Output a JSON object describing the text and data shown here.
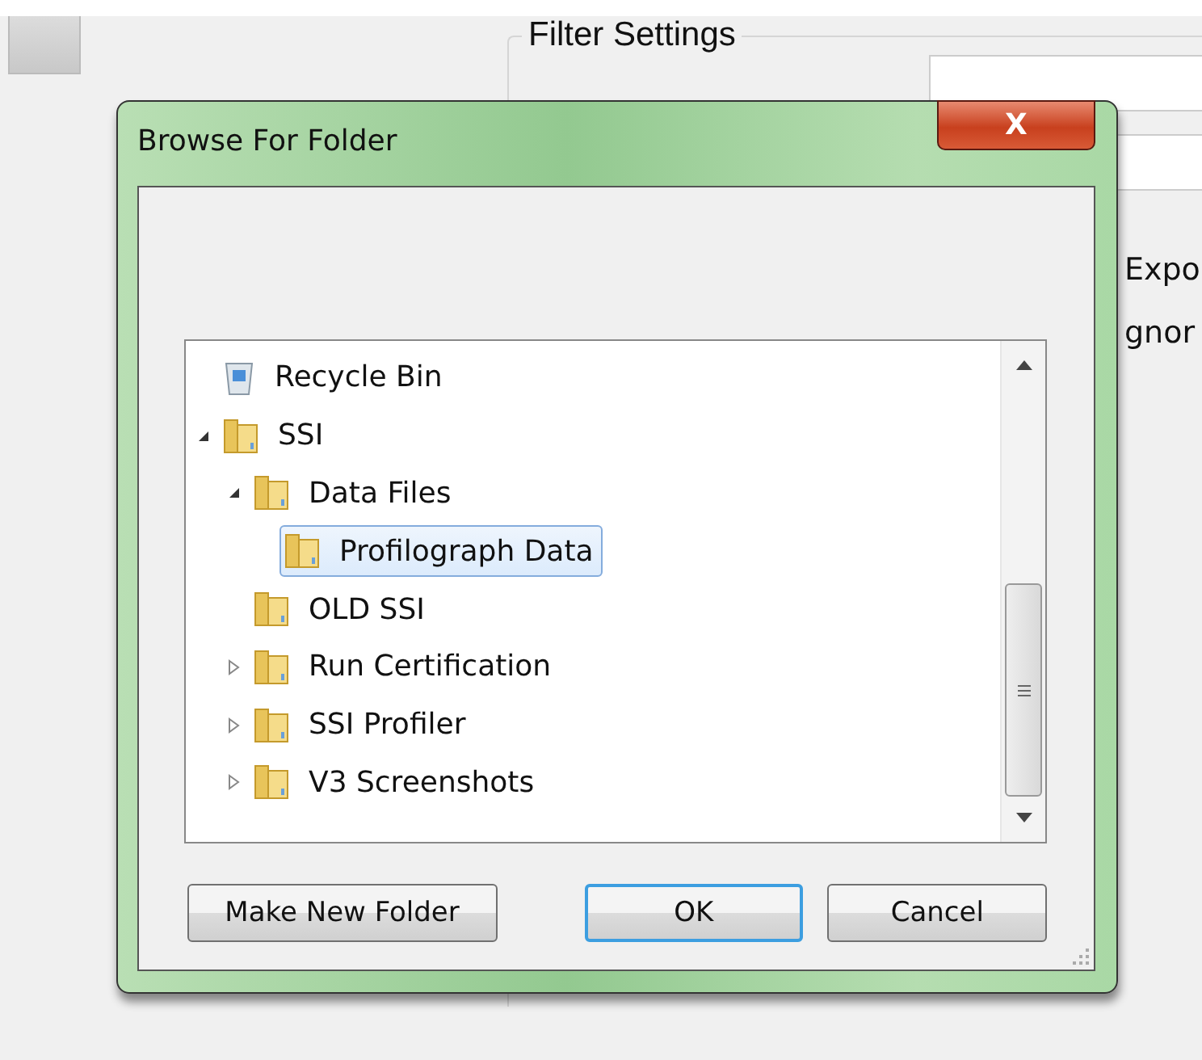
{
  "background": {
    "group_title": "Filter Settings",
    "labels": [
      "Expo",
      "gnor"
    ]
  },
  "dialog": {
    "title": "Browse For Folder",
    "close": "X",
    "tree": {
      "items": [
        {
          "kind": "bin",
          "label": "Recycle Bin",
          "selected": false
        },
        {
          "kind": "folder",
          "label": "SSI",
          "expanded": true,
          "selected": false,
          "children": [
            {
              "kind": "folder",
              "label": "Data Files",
              "expanded": true,
              "selected": false,
              "children": [
                {
                  "kind": "folder",
                  "label": "Profilograph Data",
                  "selected": true
                }
              ]
            },
            {
              "kind": "folder",
              "label": "OLD SSI",
              "selected": false
            },
            {
              "kind": "folder",
              "label": "Run Certification",
              "expanded": false,
              "selected": false
            },
            {
              "kind": "folder",
              "label": "SSI Profiler",
              "expanded": false,
              "selected": false
            },
            {
              "kind": "folder",
              "label": "V3 Screenshots",
              "expanded": false,
              "selected": false
            }
          ]
        }
      ]
    },
    "buttons": [
      {
        "label": "Make New Folder",
        "default": false
      },
      {
        "label": "OK",
        "default": true
      },
      {
        "label": "Cancel",
        "default": false
      }
    ]
  }
}
